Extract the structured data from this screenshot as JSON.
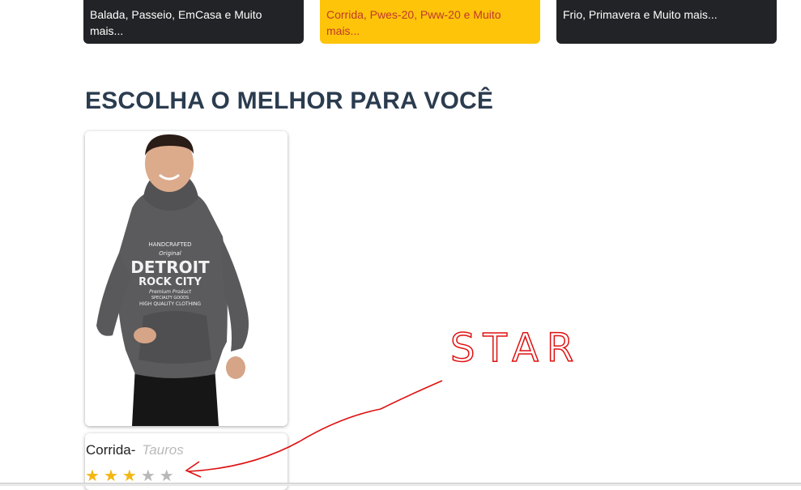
{
  "categories": [
    {
      "text": "Balada, Passeio, EmCasa e Muito mais..."
    },
    {
      "text": "Corrida, Pwes-20, Pww-20 e Muito mais..."
    },
    {
      "text": "Frio, Primavera e Muito mais..."
    }
  ],
  "section": {
    "title": "ESCOLHA O MELHOR PARA VOCÊ"
  },
  "product": {
    "name": "Corrida-",
    "brand": "Tauros",
    "rating": 3,
    "rating_max": 5,
    "hoodie_print": {
      "line1": "HANDCRAFTED",
      "line2": "Original",
      "line3": "DETROIT",
      "line4": "ROCK CITY",
      "line5": "Premium Product",
      "line6": "SPECIALTY GOODS",
      "line7": "HIGH QUALITY CLOTHING"
    }
  },
  "annotation": {
    "text": "STAR",
    "color": "#e01010"
  },
  "colors": {
    "dark_card": "#222326",
    "accent_yellow": "#fec40a",
    "accent_text_red": "#c0392b",
    "title": "#2b3c4f",
    "star_on": "#f3b612",
    "star_off": "#b8b8b8"
  }
}
